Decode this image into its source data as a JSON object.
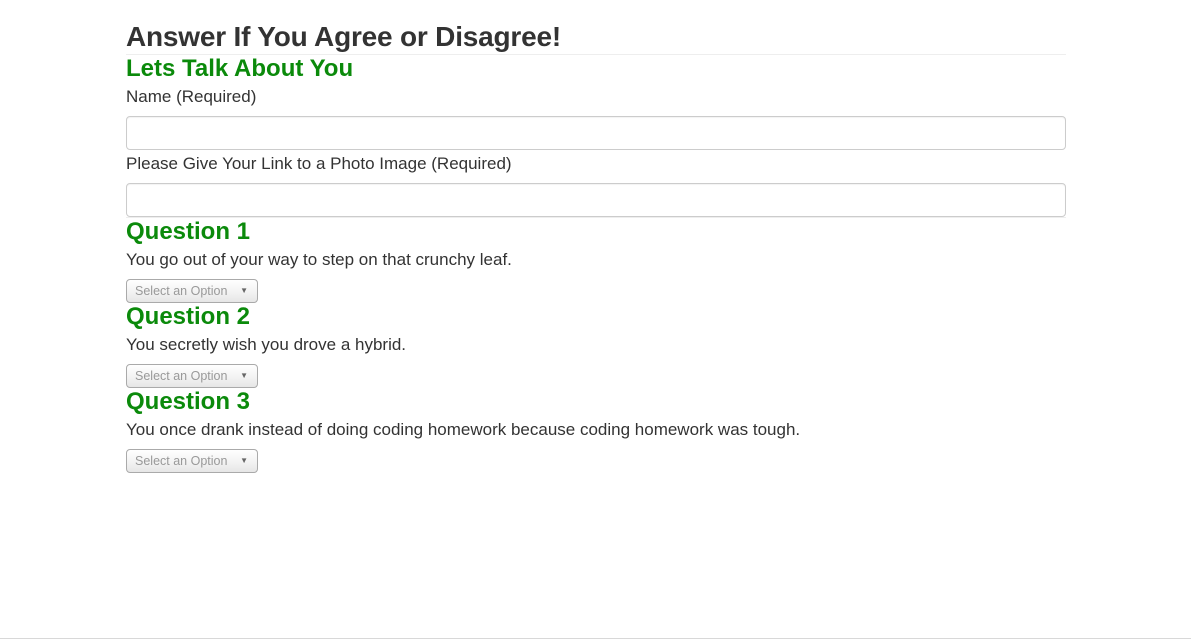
{
  "page": {
    "title": "Answer If You Agree or Disagree!"
  },
  "about": {
    "heading": "Lets Talk About You",
    "name_label": "Name (Required)",
    "name_value": "",
    "photo_label": "Please Give Your Link to a Photo Image (Required)",
    "photo_value": ""
  },
  "questions": [
    {
      "heading": "Question 1",
      "text": "You go out of your way to step on that crunchy leaf.",
      "select_placeholder": "Select an Option"
    },
    {
      "heading": "Question 2",
      "text": "You secretly wish you drove a hybrid.",
      "select_placeholder": "Select an Option"
    },
    {
      "heading": "Question 3",
      "text": "You once drank instead of doing coding homework because coding homework was tough.",
      "select_placeholder": "Select an Option"
    }
  ],
  "colors": {
    "section_heading": "#0b8a0b",
    "text": "#333333"
  },
  "icons": {
    "select_arrow": "caret-down-icon"
  }
}
